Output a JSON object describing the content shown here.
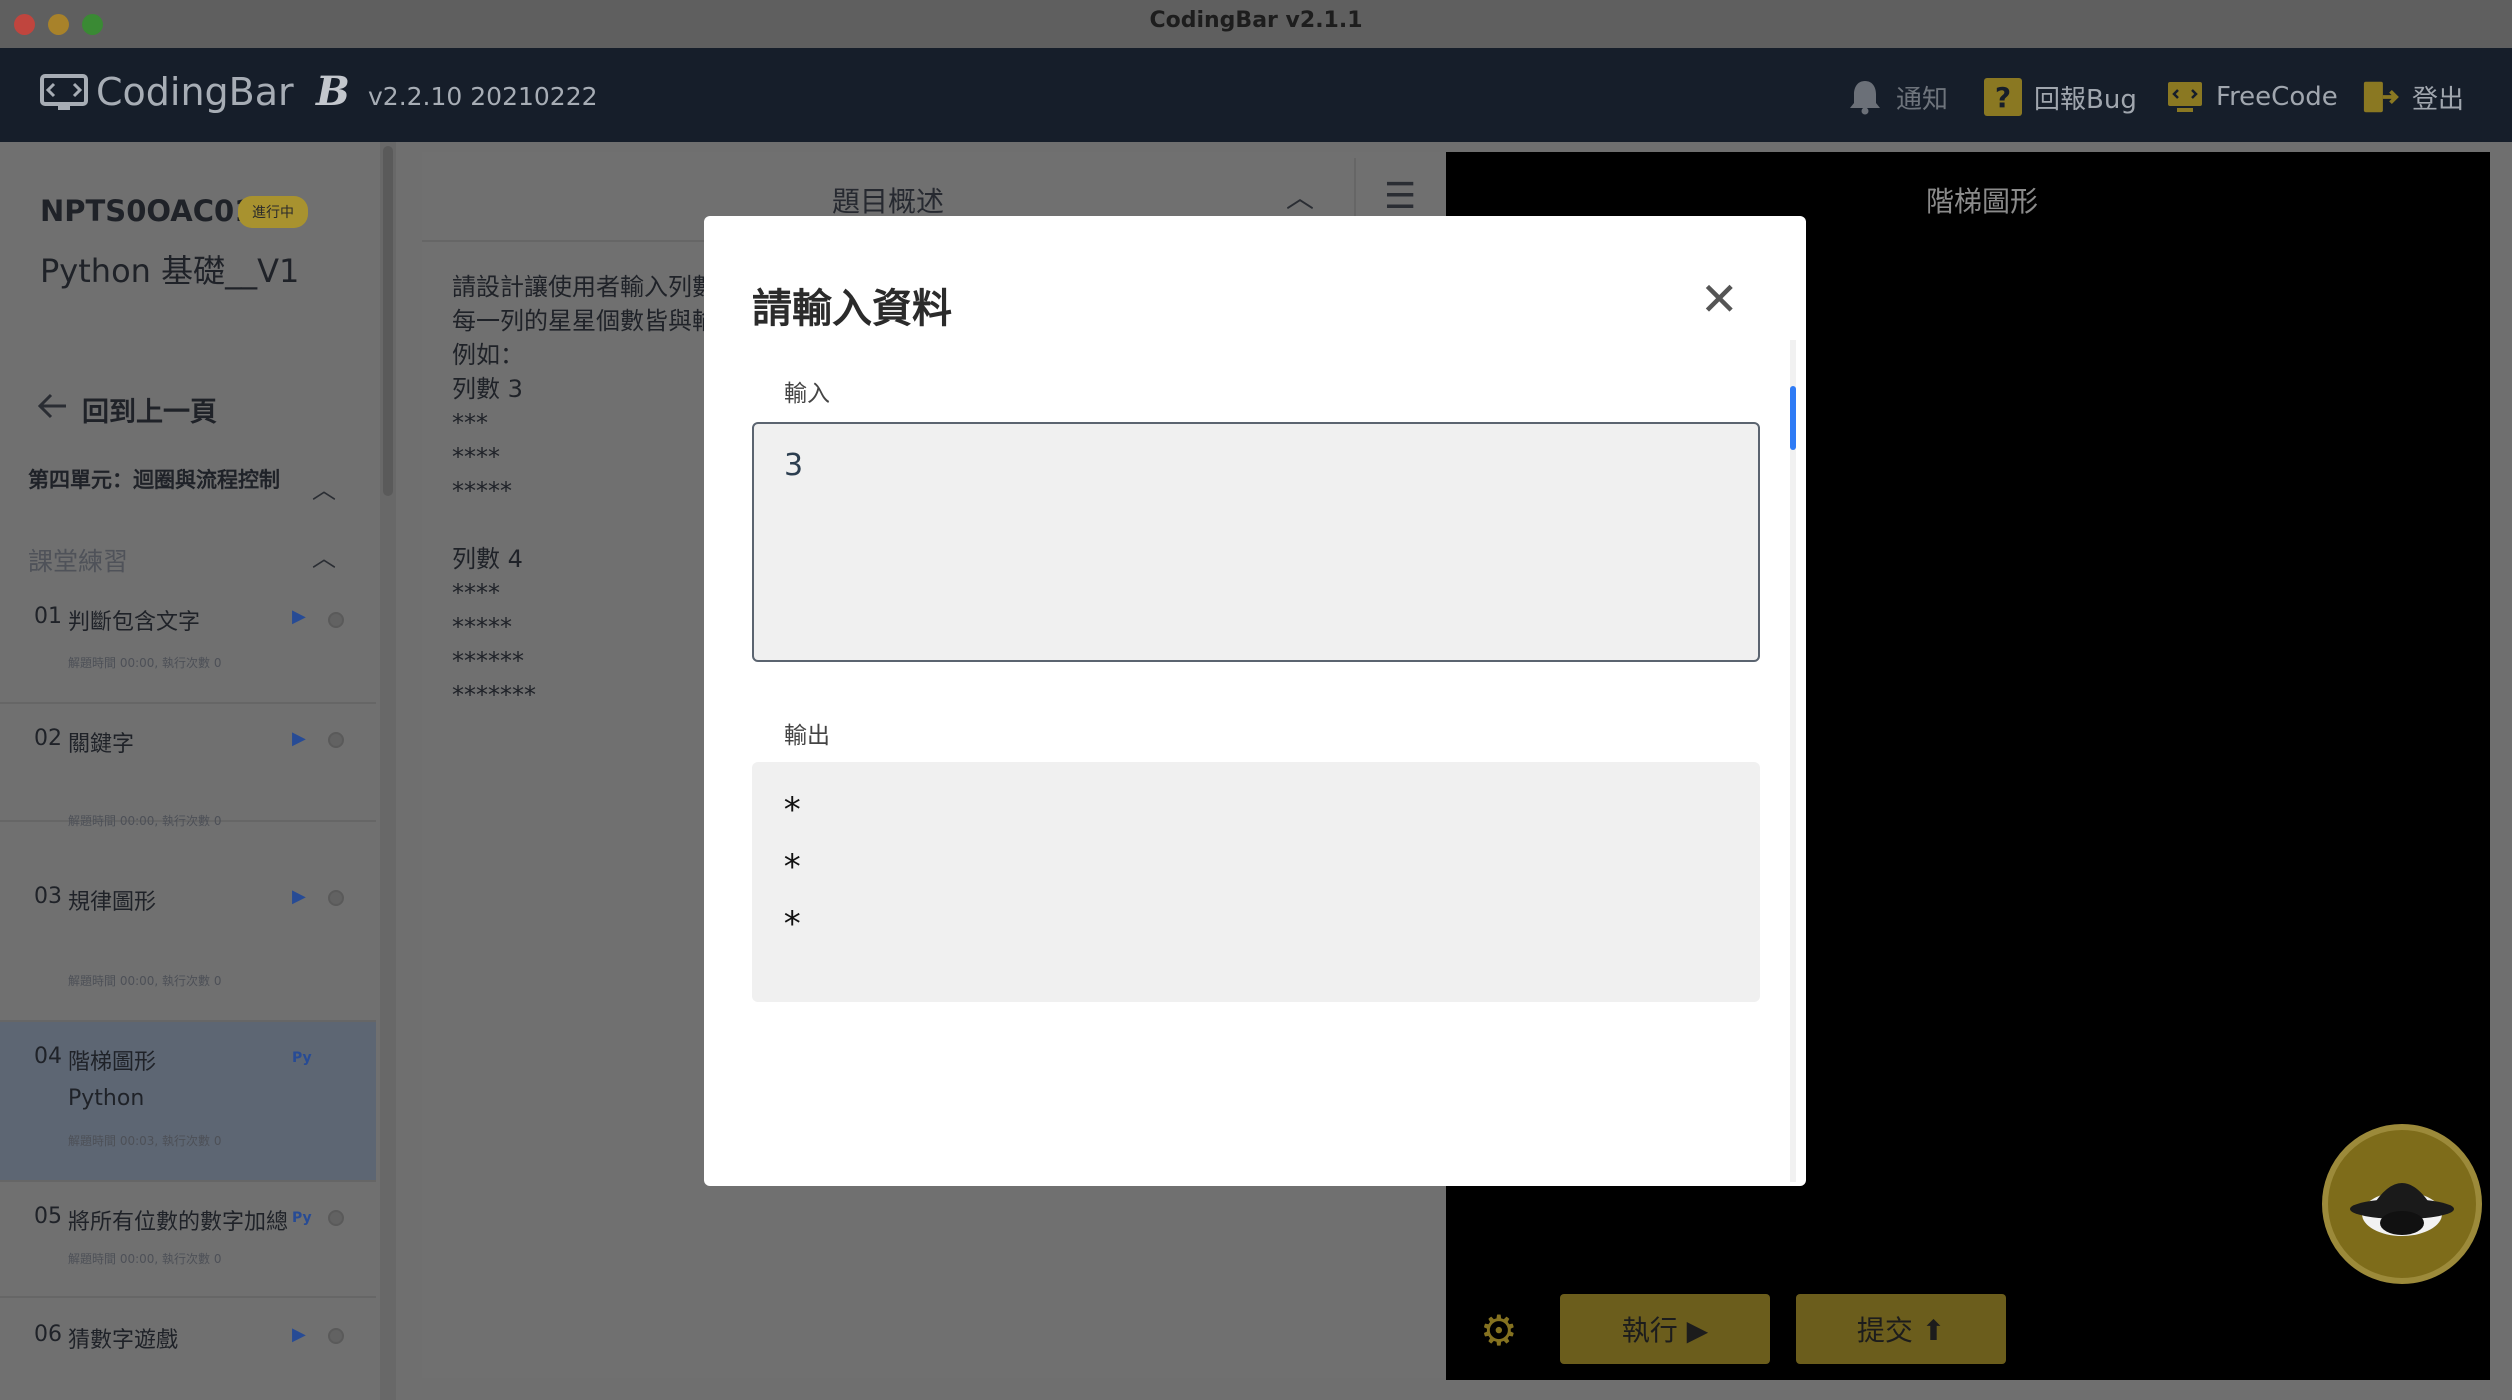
{
  "window": {
    "title": "CodingBar v2.1.1"
  },
  "header": {
    "logo_text": "CodingBar",
    "brand_mark": "B",
    "version": "v2.2.10 20210222",
    "nav": [
      {
        "label": "通知",
        "icon": "bell-icon"
      },
      {
        "label": "回報Bug",
        "icon": "question-icon"
      },
      {
        "label": "FreeCode",
        "icon": "code-monitor-icon"
      },
      {
        "label": "登出",
        "icon": "logout-icon"
      }
    ]
  },
  "sidebar": {
    "course_code": "NPTS0OAC01",
    "course_badge": "進行中",
    "course_name": "Python 基礎__V1",
    "back_label": "回到上一頁",
    "unit_title": "第四單元：迴圈與流程控制",
    "section_title": "課堂練習",
    "lessons": [
      {
        "num": "01",
        "title": "判斷包含文字",
        "meta": "解題時間 00:00, 執行次數 0"
      },
      {
        "num": "02",
        "title": "關鍵字",
        "meta": "解題時間 00:00, 執行次數 0"
      },
      {
        "num": "03",
        "title": "規律圖形",
        "meta": "解題時間 00:00, 執行次數 0"
      },
      {
        "num": "04",
        "title": "階梯圖形",
        "sub": "Python",
        "badge": "Py",
        "meta": "解題時間 00:03, 執行次數 0"
      },
      {
        "num": "05",
        "title": "將所有位數的數字加總",
        "badge": "Py",
        "meta": "解題時間 00:00, 執行次數 0"
      },
      {
        "num": "06",
        "title": "猜數字遊戲"
      }
    ]
  },
  "problem": {
    "tab_title": "題目概述",
    "text": "請設計讓使用者輸入列數\n每一列的星星個數皆與輸\n例如：\n列數 3\n***\n****\n*****\n\n列數 4\n****\n*****\n******\n*******"
  },
  "console": {
    "title": "階梯圖形",
    "run_label": "執行 ▶",
    "submit_label": "提交 ⬆"
  },
  "modal": {
    "title": "請輸入資料",
    "input_label": "輸入",
    "input_value": "3",
    "output_label": "輸出",
    "output_lines": [
      "*",
      "*",
      "*"
    ]
  },
  "colors": {
    "accent": "#f5cd2e",
    "header_bg": "#1e2a3a",
    "scroll_thumb": "#2f7bf5"
  }
}
